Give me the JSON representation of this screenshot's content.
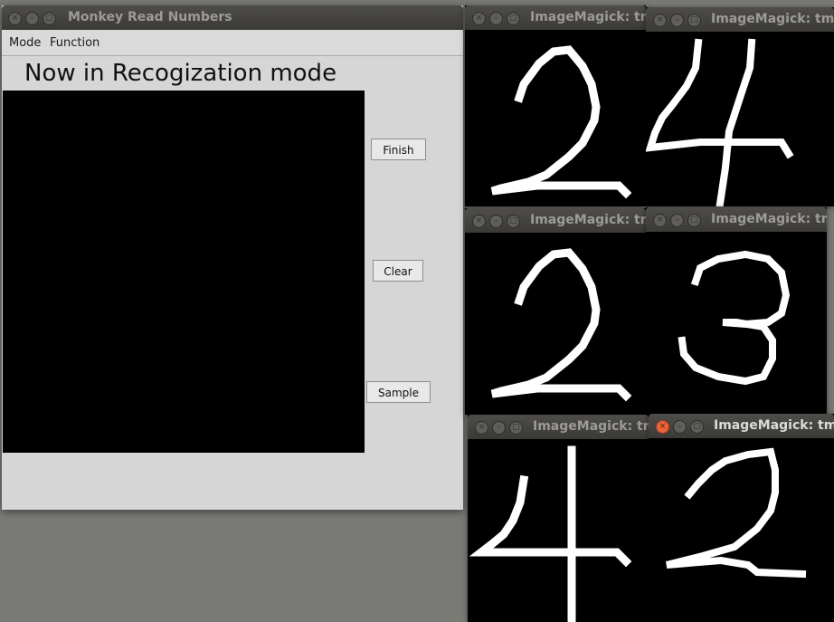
{
  "app": {
    "title": "Monkey Read Numbers",
    "menu": [
      "Mode",
      "Function"
    ],
    "mode_text": "Now in Recogization mode",
    "buttons": {
      "finish": "Finish",
      "clear": "Clear",
      "sample": "Sample"
    }
  },
  "image_windows": [
    {
      "title": "ImageMagick: tm",
      "digit": "2"
    },
    {
      "title": "ImageMagick: tm",
      "digit": "4"
    },
    {
      "title": "ImageMagick: tm",
      "digit": "2"
    },
    {
      "title": "ImageMagick: tm",
      "digit": "3"
    },
    {
      "title": "ImageMagick: tm",
      "digit": "4"
    },
    {
      "title": "ImageMagick: tm",
      "digit": "2"
    }
  ],
  "colors": {
    "desktop": "#797a75",
    "titlebar": "#3c3b37",
    "close_active": "#e9633b"
  },
  "icons": [
    "close-icon",
    "minimize-icon",
    "maximize-icon"
  ]
}
